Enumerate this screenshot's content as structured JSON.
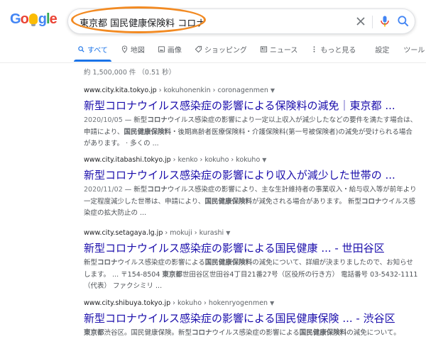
{
  "logo": {
    "letters": [
      "G",
      "o",
      "o",
      "g",
      "l",
      "e"
    ]
  },
  "search": {
    "query": "東京都 国民健康保険料 コロナ"
  },
  "tabs": [
    {
      "label": "すべて",
      "icon": "search-icon"
    },
    {
      "label": "地図",
      "icon": "map-pin-icon"
    },
    {
      "label": "画像",
      "icon": "image-icon"
    },
    {
      "label": "ショッピング",
      "icon": "tag-icon"
    },
    {
      "label": "ニュース",
      "icon": "news-icon"
    },
    {
      "label": "もっと見る",
      "icon": "more-vert-icon"
    },
    {
      "label": "設定",
      "icon": ""
    },
    {
      "label": "ツール",
      "icon": ""
    }
  ],
  "stats": "約 1,500,000 件 （0.51 秒）",
  "results": [
    {
      "domain": "www.city.kita.tokyo.jp",
      "path": " › kokuhonenkin › coronagenmen",
      "title": "新型コロナウイルス感染症の影響による保険料の減免｜東京都 ...",
      "date": "2020/10/05",
      "snippet": [
        {
          "t": " — 新型"
        },
        {
          "t": "コロナ",
          "b": true
        },
        {
          "t": "ウイルス感染症の影響により一定以上収入が減少したなどの要件を満たす場合は、申請により、"
        },
        {
          "t": "国民健康保険料",
          "b": true
        },
        {
          "t": "・後期高齢者医療保険料・介護保険料(第一号被保険者)の減免が受けられる場合があります。 · 多くの ..."
        }
      ]
    },
    {
      "domain": "www.city.itabashi.tokyo.jp",
      "path": " › kenko › kokuho › kokuho",
      "title": "新型コロナウイルス感染症の影響により収入が減少した世帯の ...",
      "date": "2020/11/02",
      "snippet": [
        {
          "t": " — 新型"
        },
        {
          "t": "コロナ",
          "b": true
        },
        {
          "t": "ウイルス感染症の影響により、主な生計維持者の事業収入・給与収入等が前年より一定程度減少した世帯は、申請により、"
        },
        {
          "t": "国民健康保険料",
          "b": true
        },
        {
          "t": "が減免される場合があります。 新型"
        },
        {
          "t": "コロナ",
          "b": true
        },
        {
          "t": "ウイルス感染症の拡大防止の ..."
        }
      ]
    },
    {
      "domain": "www.city.setagaya.lg.jp",
      "path": " › mokuji › kurashi",
      "title": "新型コロナウイルス感染症の影響による国民健康 ... - 世田谷区",
      "date": "",
      "snippet": [
        {
          "t": "新型"
        },
        {
          "t": "コロナ",
          "b": true
        },
        {
          "t": "ウイルス感染症の影響による"
        },
        {
          "t": "国民健康保険料",
          "b": true
        },
        {
          "t": "の減免について、詳細が決まりましたので、お知らせします。 ... 〒154-8504 "
        },
        {
          "t": "東京都",
          "b": true
        },
        {
          "t": "世田谷区世田谷4丁目21番27号（区役所の行き方） 電話番号 03-5432-1111（代表） ファクシミリ ..."
        }
      ]
    },
    {
      "domain": "www.city.shibuya.tokyo.jp",
      "path": " › kokuho › hokenryogenmen",
      "title": "新型コロナウイルス感染症の影響による国民健康保険 ... - 渋谷区",
      "date": "",
      "snippet": [
        {
          "t": "東京都",
          "b": true
        },
        {
          "t": "渋谷区。国民健康保険。新型"
        },
        {
          "t": "コロナ",
          "b": true
        },
        {
          "t": "ウイルス感染症の影響による"
        },
        {
          "t": "国民健康保険料",
          "b": true
        },
        {
          "t": "の減免について。"
        }
      ]
    }
  ],
  "colors": {
    "link": "#1a0dab",
    "accent": "#1a73e8",
    "highlight_oval": "#f28a22",
    "muted": "#5f6368",
    "snippet": "#4d5156"
  }
}
